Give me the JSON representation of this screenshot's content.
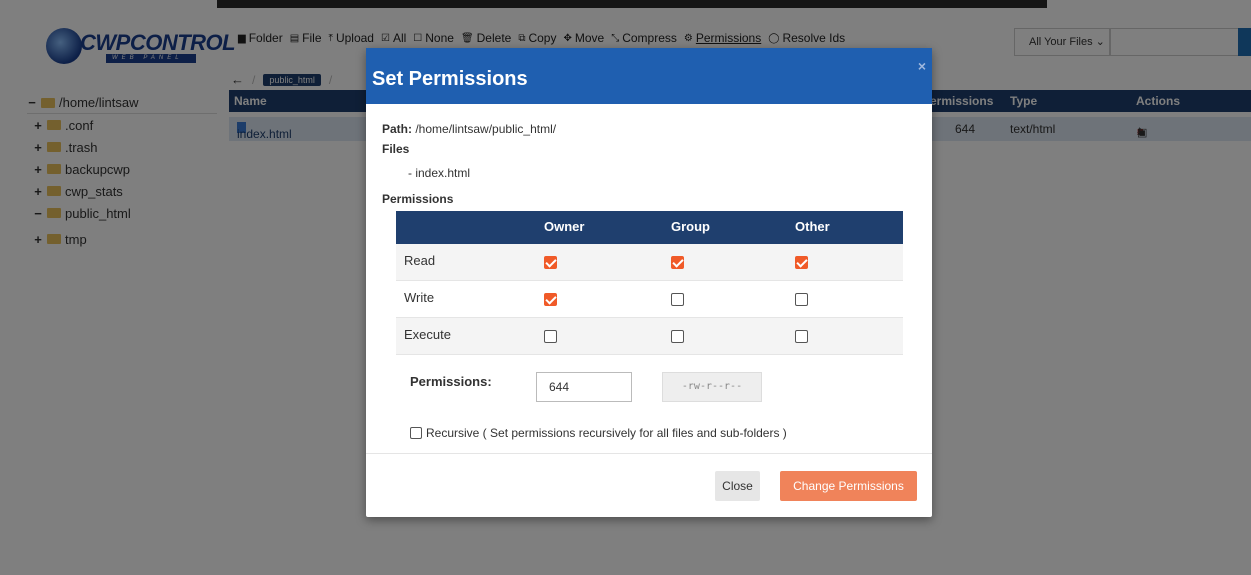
{
  "logo": {
    "brand": "CWPCONTROL",
    "tagline": "WEB PANEL"
  },
  "toolbar": [
    {
      "icon": "folder-icon",
      "glyph": "▆",
      "label": "Folder"
    },
    {
      "icon": "file-icon",
      "glyph": "▤",
      "label": "File"
    },
    {
      "icon": "upload-icon",
      "glyph": "⤒",
      "label": "Upload"
    },
    {
      "icon": "check-all-icon",
      "glyph": "☑",
      "label": "All"
    },
    {
      "icon": "check-none-icon",
      "glyph": "☐",
      "label": "None"
    },
    {
      "icon": "trash-icon",
      "glyph": "🗑",
      "label": "Delete"
    },
    {
      "icon": "copy-icon",
      "glyph": "⧉",
      "label": "Copy"
    },
    {
      "icon": "move-icon",
      "glyph": "✥",
      "label": "Move"
    },
    {
      "icon": "compress-icon",
      "glyph": "⤡",
      "label": "Compress"
    },
    {
      "icon": "permissions-icon",
      "glyph": "⚙",
      "label": "Permissions"
    },
    {
      "icon": "resolve-icon",
      "glyph": "◯",
      "label": "Resolve Ids"
    }
  ],
  "filter": {
    "label": "All Your Files"
  },
  "breadcrumb": {
    "current": "public_html"
  },
  "tree": {
    "root": "/home/lintsaw",
    "children": [
      ".conf",
      ".trash",
      "backupcwp",
      "cwp_stats",
      "public_html",
      "tmp"
    ]
  },
  "table": {
    "headers": {
      "name": "Name",
      "permissions": "ermissions",
      "type": "Type",
      "actions": "Actions"
    },
    "rows": [
      {
        "name": "index.html",
        "permissions": "644",
        "type": "text/html"
      }
    ]
  },
  "modal": {
    "title": "Set Permissions",
    "close_x": "×",
    "path_label": "Path:",
    "path_value": "/home/lintsaw/public_html/",
    "files_label": "Files",
    "file_item": "- index.html",
    "permissions_label": "Permissions",
    "columns": {
      "owner": "Owner",
      "group": "Group",
      "other": "Other"
    },
    "rows": [
      {
        "label": "Read",
        "owner": true,
        "group": true,
        "other": true
      },
      {
        "label": "Write",
        "owner": true,
        "group": false,
        "other": false
      },
      {
        "label": "Execute",
        "owner": false,
        "group": false,
        "other": false
      }
    ],
    "permissions_input_label": "Permissions:",
    "permissions_value": "644",
    "symbolic_value": "-rw-r--r--",
    "recursive_label": "Recursive ( Set permissions recursively for all files and sub-folders )",
    "close_button": "Close",
    "change_button": "Change Permissions"
  },
  "colors": {
    "header_navy": "#1f3f6e",
    "modal_blue": "#1f5fb0",
    "accent_orange": "#f05a28",
    "change_button": "#f0835a"
  }
}
